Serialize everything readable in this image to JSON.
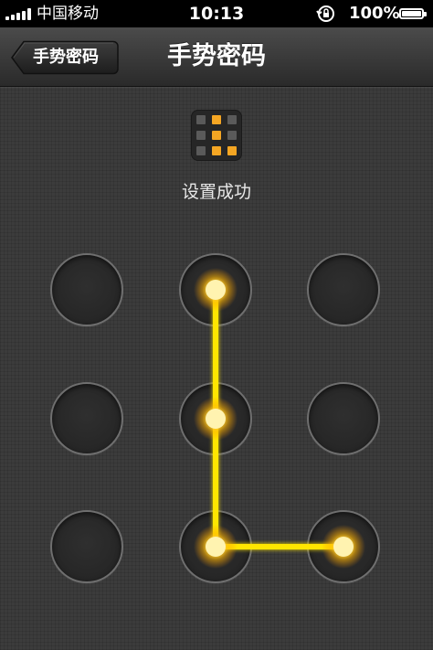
{
  "status_bar": {
    "carrier": "中国移动",
    "time": "10:13",
    "battery": "100%",
    "icons": [
      "signal-icon",
      "rotation-lock-icon",
      "battery-icon"
    ]
  },
  "nav": {
    "back_label": "手势密码",
    "title": "手势密码"
  },
  "header": {
    "icon": "pattern-grid-icon",
    "status_text": "设置成功"
  },
  "pattern": {
    "grid": "3x3",
    "selected_sequence": [
      2,
      5,
      8,
      9
    ],
    "colors": {
      "accent": "#ffd21a",
      "glow": "#ffb300",
      "ring": "#6f6f6f",
      "background": "#3c3c3c"
    }
  }
}
